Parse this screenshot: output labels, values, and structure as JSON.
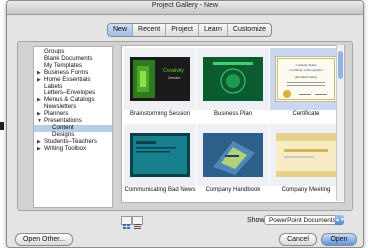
{
  "window": {
    "title": "Project Gallery - New"
  },
  "tabs": [
    {
      "label": "New",
      "active": true
    },
    {
      "label": "Recent",
      "active": false
    },
    {
      "label": "Project",
      "active": false
    },
    {
      "label": "Learn",
      "active": false
    },
    {
      "label": "Customize",
      "active": false
    }
  ],
  "categories_header": "Groups",
  "categories": [
    {
      "label": "Blank Documents",
      "level": 0,
      "expander": ""
    },
    {
      "label": "My Templates",
      "level": 0,
      "expander": ""
    },
    {
      "label": "Business Forms",
      "level": 0,
      "expander": "▶"
    },
    {
      "label": "Home Essentials",
      "level": 0,
      "expander": "▶"
    },
    {
      "label": "Labels",
      "level": 0,
      "expander": ""
    },
    {
      "label": "Letters–Envelopes",
      "level": 0,
      "expander": ""
    },
    {
      "label": "Menus & Catalogs",
      "level": 0,
      "expander": "▶"
    },
    {
      "label": "Newsletters",
      "level": 0,
      "expander": ""
    },
    {
      "label": "Planners",
      "level": 0,
      "expander": "▶"
    },
    {
      "label": "Presentations",
      "level": 0,
      "expander": "▼"
    },
    {
      "label": "Content",
      "level": 1,
      "expander": "",
      "selected": true
    },
    {
      "label": "Designs",
      "level": 1,
      "expander": ""
    },
    {
      "label": "Students–Teachers",
      "level": 0,
      "expander": "▶"
    },
    {
      "label": "Writing Toolbox",
      "level": 0,
      "expander": "▶"
    }
  ],
  "templates": [
    {
      "label": "Brainstorming Session",
      "slide_title": "Creativity",
      "slide_sub": "Session",
      "bg": "#1b1b1b",
      "accent": "#5fd12c"
    },
    {
      "label": "Business Plan",
      "bg": "#0f6b3a",
      "accent": "#3fd06a"
    },
    {
      "label": "Certificate",
      "cert_line1": "Company Name",
      "cert_line2": "Certificate of Recognition",
      "cert_line3": "[Recipient Name]",
      "bg": "#fdfbf0",
      "accent": "#2a3c8a",
      "selected": true
    },
    {
      "label": "Communicating Bad News",
      "bg": "#17808f",
      "accent": "#0b3f4a"
    },
    {
      "label": "Company Handbook",
      "bg": "#2e5f8a",
      "accent": "#c9e36a"
    },
    {
      "label": "Company Meeting",
      "bg": "#f7ecc4",
      "accent": "#d2b45a"
    }
  ],
  "footer": {
    "show_label": "Show:",
    "show_value": "PowerPoint Documents",
    "open_other": "Open Other...",
    "cancel": "Cancel",
    "open": "Open"
  }
}
